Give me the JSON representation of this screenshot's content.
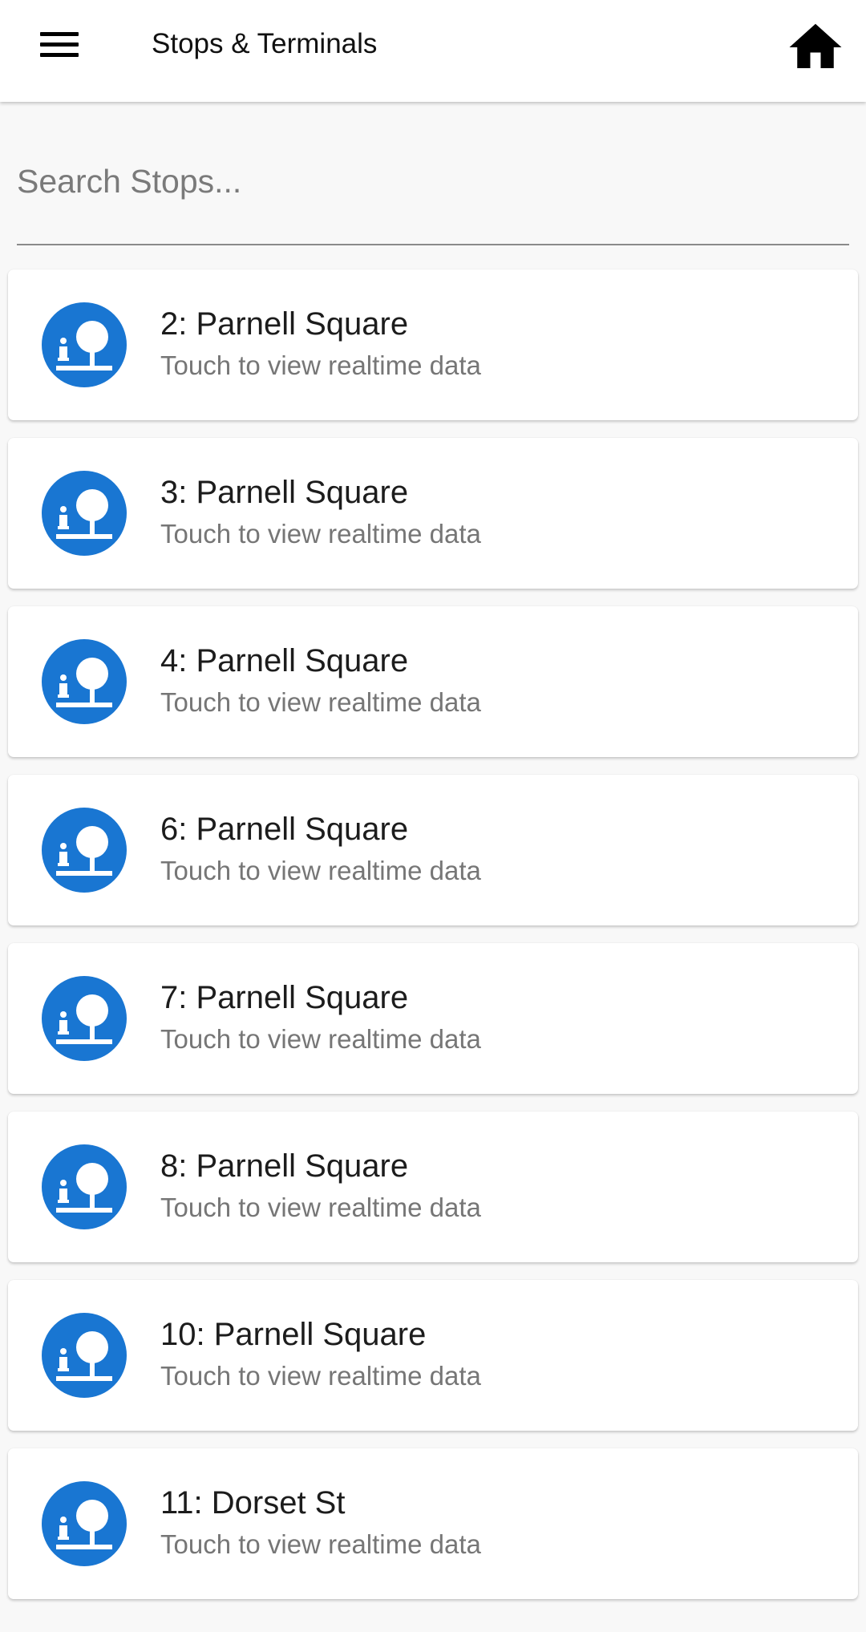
{
  "appbar": {
    "title": "Stops & Terminals",
    "menu_icon": "menu-icon",
    "home_icon": "home-icon"
  },
  "search": {
    "placeholder": "Search Stops...",
    "value": ""
  },
  "colors": {
    "accent": "#1976d2",
    "background": "#f8f8f8",
    "card": "#ffffff"
  },
  "stops": [
    {
      "title": "2: Parnell Square",
      "subtitle": "Touch to view realtime data",
      "icon": "stop-shelter-icon"
    },
    {
      "title": "3: Parnell Square",
      "subtitle": "Touch to view realtime data",
      "icon": "stop-shelter-icon"
    },
    {
      "title": "4: Parnell Square",
      "subtitle": "Touch to view realtime data",
      "icon": "stop-shelter-icon"
    },
    {
      "title": "6: Parnell Square",
      "subtitle": "Touch to view realtime data",
      "icon": "stop-shelter-icon"
    },
    {
      "title": "7: Parnell Square",
      "subtitle": "Touch to view realtime data",
      "icon": "stop-shelter-icon"
    },
    {
      "title": "8: Parnell Square",
      "subtitle": "Touch to view realtime data",
      "icon": "stop-shelter-icon"
    },
    {
      "title": "10: Parnell Square",
      "subtitle": "Touch to view realtime data",
      "icon": "stop-shelter-icon"
    },
    {
      "title": "11: Dorset St",
      "subtitle": "Touch to view realtime data",
      "icon": "stop-shelter-icon"
    }
  ]
}
